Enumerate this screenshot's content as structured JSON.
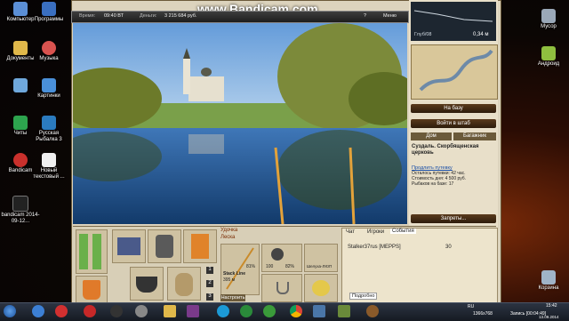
{
  "watermark": "www.Bandicam.com",
  "desktop": {
    "left_icons": [
      {
        "label": "Компьютер",
        "color": "#5b8fd6"
      },
      {
        "label": "Программы",
        "color": "#3a6fc0"
      },
      {
        "label": "Документы",
        "color": "#e0b84a"
      },
      {
        "label": "Музыка",
        "color": "#d9534f"
      },
      {
        "label": "",
        "color": "#6fa8dc"
      },
      {
        "label": "Картинки",
        "color": "#4a90d9"
      },
      {
        "label": "Читы",
        "color": "#2da44e"
      },
      {
        "label": "Русская Рыбалка 3",
        "color": "#2b7bbf"
      },
      {
        "label": "Bandicam",
        "color": "#c9302c"
      },
      {
        "label": "Новый текстовый ...",
        "color": "#f0f0f0"
      },
      {
        "label": "bandicam 2014-09-12...",
        "color": "#222"
      }
    ],
    "right_icons": [
      {
        "label": "Мусор",
        "color": "#9aa8b8"
      },
      {
        "label": "Андроид",
        "color": "#8fbf3f"
      },
      {
        "label": "Корзина",
        "color": "#a0b4c8"
      }
    ]
  },
  "game": {
    "topbar": {
      "time_label": "Время:",
      "time": "09:40 ВТ",
      "money_label": "Деньги:",
      "money": "3 215 684 руб.",
      "help": "?",
      "menu": "Меню"
    },
    "depth": {
      "label": "Глуб/08",
      "value": "0,34 м"
    },
    "buttons": {
      "to_base": "На базу",
      "to_hq": "Войти в штаб",
      "home": "Дом",
      "baggage": "Багажник",
      "bans": "Запреты..."
    },
    "location": {
      "title": "Суздаль. Скорбященская церковь",
      "extend": "Продлить путевку",
      "days_left": "Осталось путевки: 42 час.",
      "cost": "Стоимость дня: 4 500 руб.",
      "fishers": "Рыбаков на базе: 17"
    },
    "bottom": {
      "line_name": "Stack Line",
      "line_len": "395 м",
      "setup": "Настроить",
      "rod_tab1": "Удочка",
      "rod_tab2": "Леска",
      "pct1": "81%",
      "pct2": "100",
      "pct3": "82%",
      "bait": "Шелуха-ЛЮП",
      "slot1": "1",
      "slot2": "2",
      "slot3": "3"
    },
    "chat": {
      "tabs": [
        "Чат",
        "Игроки",
        "События"
      ],
      "rows": [
        {
          "name": "Stalker37rus [MEPPS]",
          "count": "30"
        }
      ],
      "details": "Подробно"
    }
  },
  "taskbar": {
    "lang": "RU",
    "resolution": "1366x768",
    "record": "Запись [00:04:49]",
    "time": "15:42",
    "date": "13.09.2014"
  }
}
